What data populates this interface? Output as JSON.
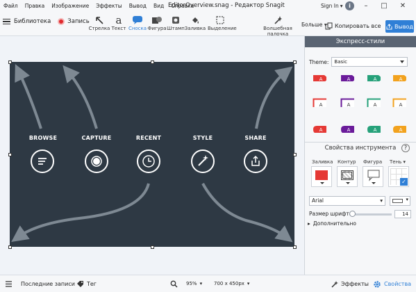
{
  "menu": [
    "Файл",
    "Правка",
    "Изображение",
    "Эффекты",
    "Вывод",
    "Вид",
    "Справка"
  ],
  "window": {
    "title": "EditorOverview.snag - Редактор Snagit",
    "signin": "Sign In",
    "avatar_letter": "i",
    "min": "–",
    "max": "□",
    "close": "✕"
  },
  "toolbar": {
    "library": "Библиотека",
    "record": "Запись",
    "tools": [
      "Стрелка",
      "Текст",
      "Сноска",
      "Фигура",
      "Штамп",
      "Заливка",
      "Выделение"
    ],
    "text_glyph": "a",
    "magic": "Волшебная палочка",
    "more": "Больше",
    "copy_all": "Копировать все",
    "share": "Вывод"
  },
  "canvas": {
    "categories": [
      "BROWSE",
      "CAPTURE",
      "RECENT",
      "STYLE",
      "SHARE"
    ],
    "bg_color": "#2e3944"
  },
  "panel": {
    "quick_styles": "Экспресс-стили",
    "theme_label": "Theme:",
    "theme_value": "Basic",
    "style_letter": "A",
    "tool_props": "Свойства инструмента",
    "help": "?",
    "props": [
      "Заливка",
      "Контур",
      "Фигура",
      "Тень"
    ],
    "font": "Arial",
    "font_size_label": "Размер шрифта",
    "font_size": "14",
    "advanced": "Дополнительно",
    "colors": [
      "#e53935",
      "#6a1b9a",
      "#26a17a",
      "#f2a21e"
    ]
  },
  "status": {
    "recent": "Последние записи",
    "tag": "Тег",
    "zoom": "95%",
    "dims": "700 x 450px",
    "effects": "Эффекты",
    "properties": "Свойства"
  }
}
